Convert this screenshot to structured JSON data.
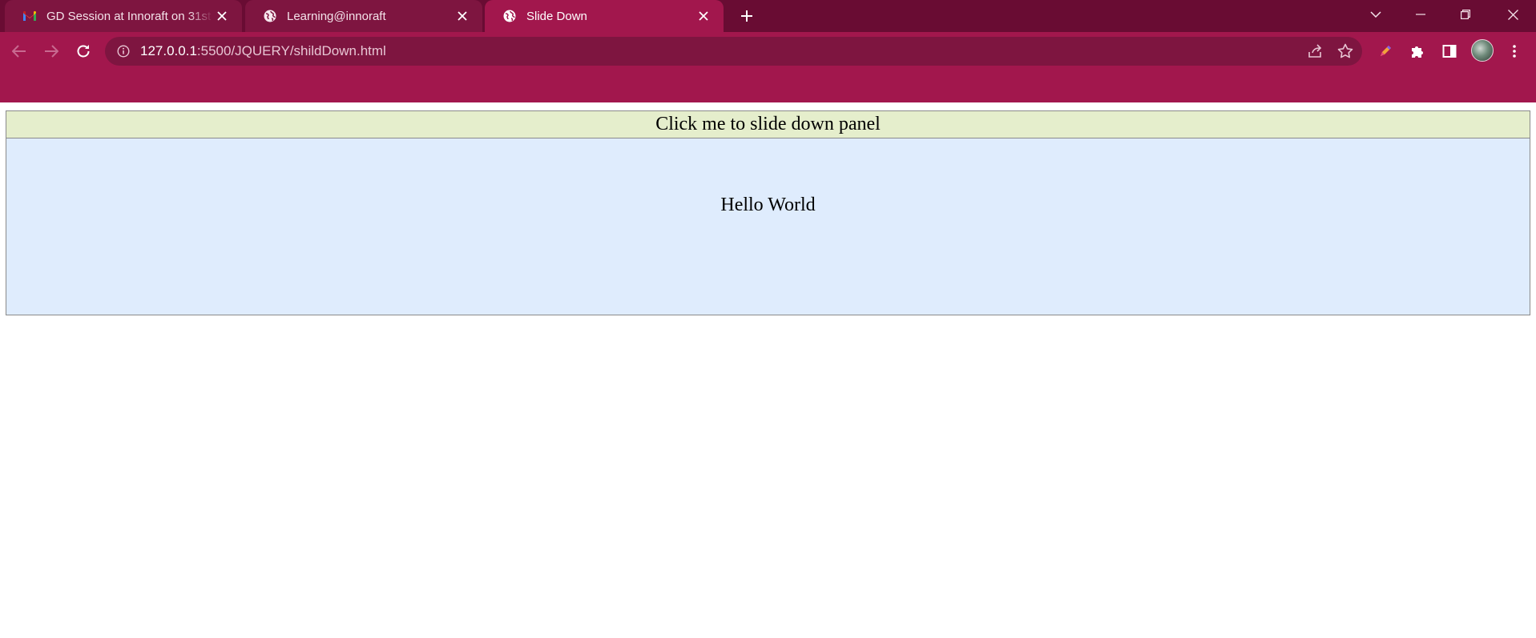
{
  "browser": {
    "tabs": [
      {
        "title": "GD Session at Innoraft on 31st Oc",
        "favicon": "gmail-icon",
        "active": false
      },
      {
        "title": "Learning@innoraft",
        "favicon": "globe-icon",
        "active": false
      },
      {
        "title": "Slide Down",
        "favicon": "globe-icon",
        "active": true
      }
    ],
    "url_host": "127.0.0.1",
    "url_rest": ":5500/JQUERY/shildDown.html",
    "colors": {
      "tabstrip": "#690c33",
      "toolbar": "#a2174d",
      "omnibox": "#7e1540"
    }
  },
  "page": {
    "flip_label": "Click me to slide down panel",
    "panel_text": "Hello World",
    "colors": {
      "flip_bg": "#e5eecc",
      "panel_bg": "#dfecfd"
    }
  }
}
